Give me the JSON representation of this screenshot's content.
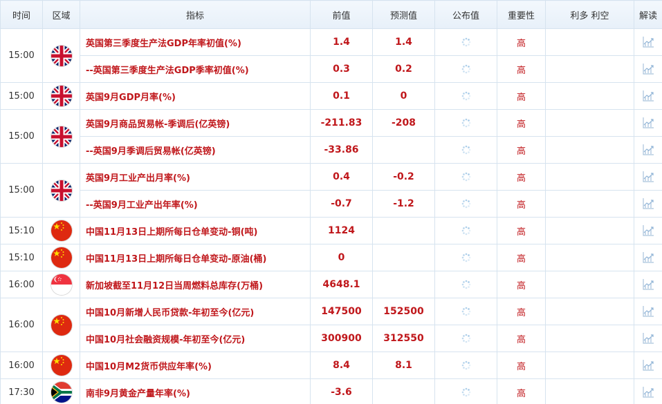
{
  "header": {
    "time": "时间",
    "region": "区域",
    "indicator": "指标",
    "previous": "前值",
    "forecast": "预测值",
    "actual": "公布值",
    "importance": "重要性",
    "impact": "利多 利空",
    "analysis": "解读"
  },
  "groups": [
    {
      "time": "15:00",
      "flag": "uk",
      "rows": [
        {
          "indicator": "英国第三季度生产法GDP年率初值(%)",
          "previous": "1.4",
          "forecast": "1.4",
          "importance": "高"
        },
        {
          "indicator": "--英国第三季度生产法GDP季率初值(%)",
          "previous": "0.3",
          "forecast": "0.2",
          "importance": "高"
        }
      ]
    },
    {
      "time": "15:00",
      "flag": "uk",
      "rows": [
        {
          "indicator": "英国9月GDP月率(%)",
          "previous": "0.1",
          "forecast": "0",
          "importance": "高"
        }
      ]
    },
    {
      "time": "15:00",
      "flag": "uk",
      "rows": [
        {
          "indicator": "英国9月商品贸易帐-季调后(亿英镑)",
          "previous": "-211.83",
          "forecast": "-208",
          "importance": "高"
        },
        {
          "indicator": "--英国9月季调后贸易帐(亿英镑)",
          "previous": "-33.86",
          "forecast": "",
          "importance": "高"
        }
      ]
    },
    {
      "time": "15:00",
      "flag": "uk",
      "rows": [
        {
          "indicator": "英国9月工业产出月率(%)",
          "previous": "0.4",
          "forecast": "-0.2",
          "importance": "高"
        },
        {
          "indicator": "--英国9月工业产出年率(%)",
          "previous": "-0.7",
          "forecast": "-1.2",
          "importance": "高"
        }
      ]
    },
    {
      "time": "15:10",
      "flag": "cn",
      "rows": [
        {
          "indicator": "中国11月13日上期所每日仓单变动-铜(吨)",
          "previous": "1124",
          "forecast": "",
          "importance": "高"
        }
      ]
    },
    {
      "time": "15:10",
      "flag": "cn",
      "rows": [
        {
          "indicator": "中国11月13日上期所每日仓单变动-原油(桶)",
          "previous": "0",
          "forecast": "",
          "importance": "高"
        }
      ]
    },
    {
      "time": "16:00",
      "flag": "sg",
      "rows": [
        {
          "indicator": "新加坡截至11月12日当周燃料总库存(万桶)",
          "previous": "4648.1",
          "forecast": "",
          "importance": "高"
        }
      ]
    },
    {
      "time": "16:00",
      "flag": "cn",
      "rows": [
        {
          "indicator": "中国10月新增人民币贷款-年初至今(亿元)",
          "previous": "147500",
          "forecast": "152500",
          "importance": "高"
        },
        {
          "indicator": "中国10月社会融资规模-年初至今(亿元)",
          "previous": "300900",
          "forecast": "312550",
          "importance": "高"
        }
      ]
    },
    {
      "time": "16:00",
      "flag": "cn",
      "rows": [
        {
          "indicator": "中国10月M2货币供应年率(%)",
          "previous": "8.4",
          "forecast": "8.1",
          "importance": "高"
        }
      ]
    },
    {
      "time": "17:30",
      "flag": "za",
      "rows": [
        {
          "indicator": "南非9月黄金产量年率(%)",
          "previous": "-3.6",
          "forecast": "",
          "importance": "高"
        }
      ]
    }
  ],
  "icons": {
    "actual_pending": "loading-spinner-icon",
    "analysis": "line-chart-icon"
  },
  "colors": {
    "indicator_text": "#c0171b",
    "header_bg": "#e7f0f9",
    "border": "#d6e3ef"
  }
}
